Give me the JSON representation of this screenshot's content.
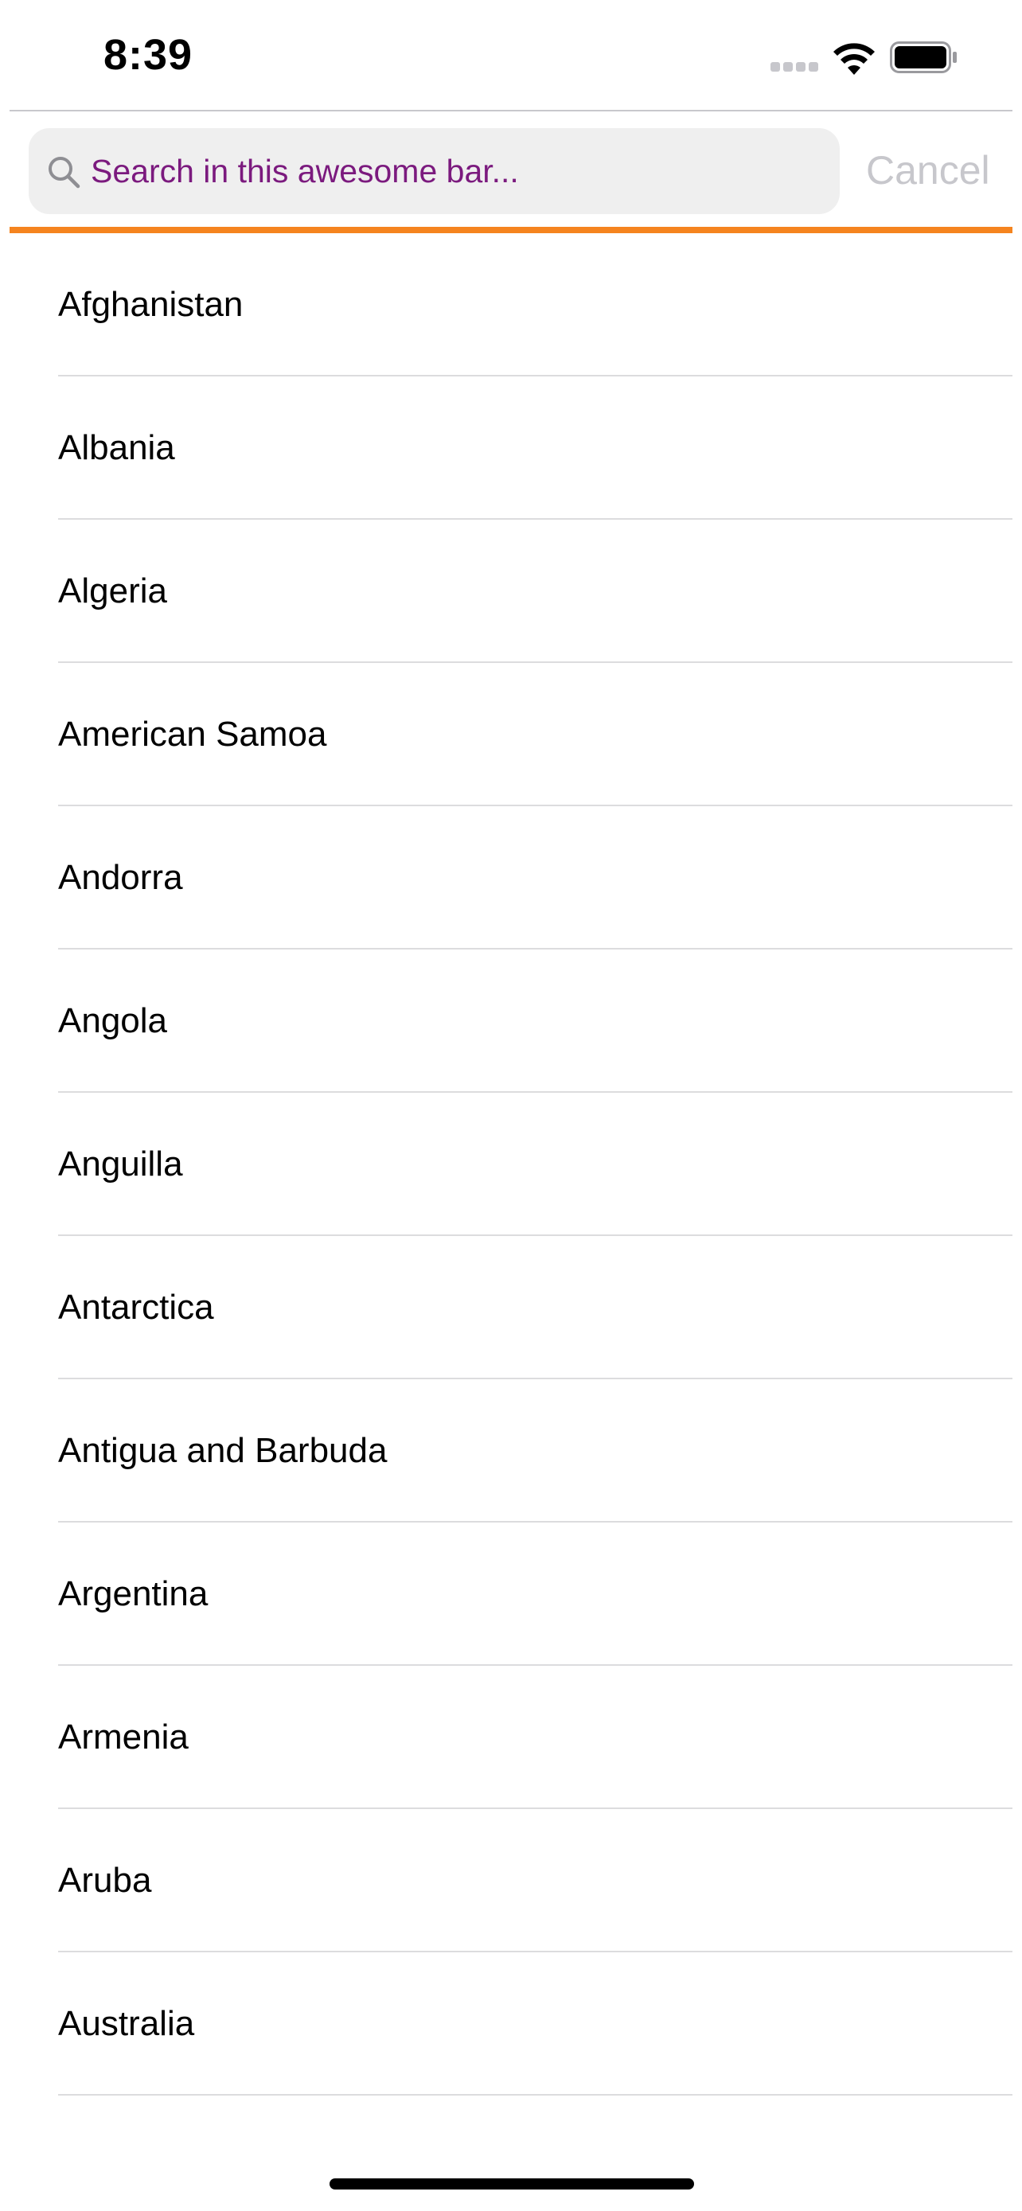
{
  "status_bar": {
    "time": "8:39",
    "icons": [
      "cellular-signal-icon",
      "wifi-icon",
      "battery-icon"
    ]
  },
  "search": {
    "placeholder": "Search in this awesome bar...",
    "value": "",
    "cancel_label": "Cancel"
  },
  "colors": {
    "accent": "#f5841f",
    "placeholder_text": "#7b1a7e",
    "cancel_text": "#c7c7cc",
    "search_background": "#efefef"
  },
  "countries": [
    "Afghanistan",
    "Albania",
    "Algeria",
    "American Samoa",
    "Andorra",
    "Angola",
    "Anguilla",
    "Antarctica",
    "Antigua and Barbuda",
    "Argentina",
    "Armenia",
    "Aruba",
    "Australia"
  ]
}
